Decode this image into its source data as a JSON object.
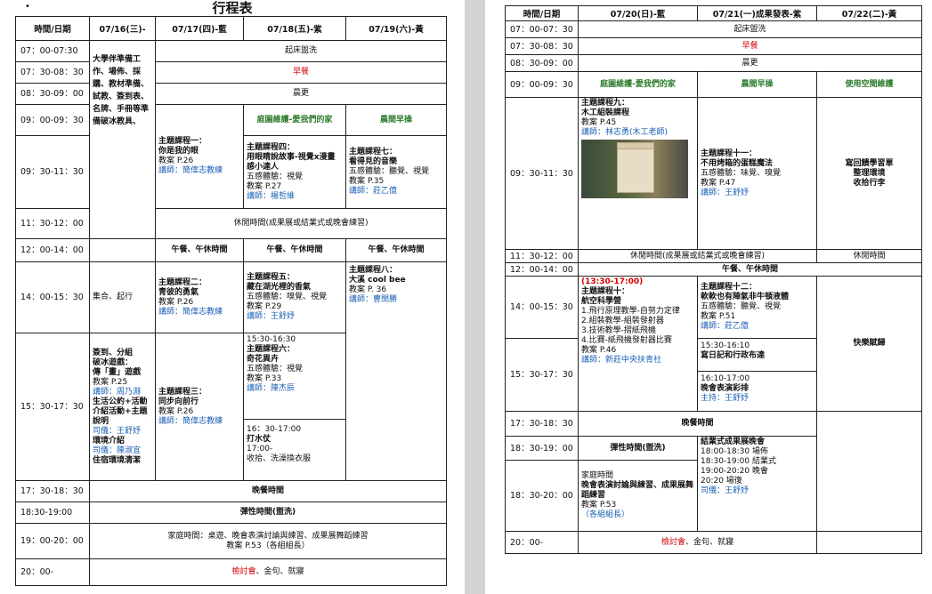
{
  "page1": {
    "title": "行程表",
    "headers": [
      "時間/日期",
      "07/16(三)-",
      "07/17(四)-藍",
      "07/18(五)-紫",
      "07/19(六)-黃"
    ],
    "times": [
      "07：00-07:30",
      "07：30-08：30",
      "08：30-09：00",
      "09：00-09：30",
      "09：30-11：30",
      "11：30-12：00",
      "12：00-14：00",
      "14：00-15：30",
      "15：30-17：30",
      "17：30-18：30",
      "18:30-19:00",
      "19：00-20：00",
      "20：00-"
    ],
    "wake": "起床盥洗",
    "breakfast": "早餐",
    "morning": "晨更",
    "d16_morning": "大學伴準備工作、場佈、採購、教材準備、試教、簽到表、名牌、手冊等準備破冰教具、",
    "d18_0900": "庭園維護-愛我們的家",
    "d19_0900": "晨間早操",
    "d17_am": {
      "l1": "主題課程一：",
      "l2": "你是我的眼",
      "l3": "教案 P.26",
      "l4": "講師：簡偉志教練"
    },
    "d18_am": {
      "l1": "主題課程四：",
      "l2": "用眼睛說故事-視覺x漫畫感小達人",
      "l3": "五感體驗：視覺",
      "l4": "教案 P.27",
      "l5": "講師：楊哲維"
    },
    "d19_am": {
      "l1": "主題課程七：",
      "l2": "看得見的音樂",
      "l3": "五感體驗：聽覺、視覺",
      "l4": "教案 P.35",
      "l5": "講師：莊乙億"
    },
    "rest": "休閒時間(成果展或結業式或晚會練習)",
    "lunch": "午餐、午休時間",
    "d16_gather": "集合、起行",
    "d17_pm1": {
      "l1": "主題課程二：",
      "l2": "青彼的勇氣",
      "l3": "教案 P.26",
      "l4": "講師：簡偉志教練"
    },
    "d18_pm1": {
      "l1": "主題課程五：",
      "l2": "藏在湖光裡的香氣",
      "l3": "五感體驗：嗅覺、視覺",
      "l4": "教案 P.29",
      "l5": "講師：王舒妤"
    },
    "d19_pm1": {
      "l1": "主題課程八：",
      "l2": "大溪 cool bee",
      "l3": "教案 P. 36",
      "l4": "講師：曹閔勝"
    },
    "d16_pm2": {
      "l1": "簽到、分組",
      "l2": "破冰遊戲：",
      "l3": "傳「畫」遊戲",
      "l4": "教案 P.25",
      "l5": "講師：周乃淵",
      "l6": "生活公約+活動介紹活動+主題說明",
      "l7": "司儀：王舒妤",
      "l8": "環境介紹",
      "l9": "司儀：陳淑宜",
      "l10": "住宿環境清潔"
    },
    "d17_pm2": {
      "l1": "主題課程三：",
      "l2": "同步向前行",
      "l3": "教案 P.26",
      "l4": "講師：簡偉志教練"
    },
    "d18_pm2a": {
      "l1": "15:30-16:30",
      "l2": "主題課程六：",
      "l3": "奇花異卉",
      "l4": "五感體驗：視覺",
      "l5": "教案 P.33",
      "l6": "講師：陳杰辰"
    },
    "d18_pm2b": {
      "l1": "16：30-17:00",
      "l2": "打水仗",
      "l3": "17:00-",
      "l4": "收拾、洗澡換衣服"
    },
    "dinner": "晚餐時間",
    "flex": "彈性時間(盥洗)",
    "evening_l1": "家庭時間：桌遊、晚會表演討論與練習、成果展舞蹈練習",
    "evening_l2": "教案 P.53（各組組長）",
    "night_red": "檢討會",
    "night_rest": "、金句、就寢"
  },
  "page2": {
    "headers": [
      "時間/日期",
      "07/20(日)-藍",
      "07/21(一)成果發表-紫",
      "07/22(二)-黃"
    ],
    "times": [
      "07：00-07：30",
      "07：30-08：30",
      "08：30-09：00",
      "09：00-09：30",
      "09：30-11：30",
      "11：30-12：00",
      "12：00-14：00",
      "14：00-15：30",
      "15：30-17：30",
      "17：30-18：30",
      "18：30-19：00",
      "18：30-20：00",
      "20：00-"
    ],
    "wake": "起床盥洗",
    "breakfast": "早餐",
    "morning": "晨更",
    "d20_0900": "庭園維護-愛我們的家",
    "d21_0900": "晨間早操",
    "d22_0900": "使用空間維護",
    "d20_am": {
      "l1": "主題課程九：",
      "l2": "木工組裝課程",
      "l3": "教案 P.45",
      "l4": "講師：林志勇(木工老師)"
    },
    "d21_am": {
      "l1": "主題課程十一：",
      "l2": "不用烤箱的蛋糕魔法",
      "l3": "五感體驗：味覺、嗅覺",
      "l4": "教案 P.47",
      "l5": "講師：王舒妤"
    },
    "d22_am": {
      "l1": "寫回饋學習單",
      "l2": "整理環境",
      "l3": "收拾行李"
    },
    "rest": "休閒時間(成果展或結業式或晚會練習)",
    "d22_rest": "休閒時間",
    "lunch": "午餐、午休時間",
    "d20_pm": {
      "l1": "(13:30-17:00)",
      "l2": "主題課程十：",
      "l3": "航空科學營",
      "l4": "1.飛行原理教學-自努力定律",
      "l5": "2.組裝教學-組裝發射器",
      "l6": "3.技術教學-摺紙飛機",
      "l7": "4.比賽-紙飛機發射器比賽",
      "l8": "教案 P.46",
      "l9": "講師：新莊中央扶青社"
    },
    "d21_pm1": {
      "l1": "主題課程十二：",
      "l2": "軟軟也有陣氣非牛頓液體",
      "l3": "五感體驗：聽覺、視覺",
      "l4": "教案 P.51",
      "l5": "講師：莊乙億"
    },
    "d21_pm2": {
      "l1": "15:30-16:10",
      "l2": "寫日記和行政布達"
    },
    "d21_pm3": {
      "l1": "16:10-17:00",
      "l2": "晚會表演彩排",
      "l3": "主持：王舒妤"
    },
    "d22_pm": "快樂賦歸",
    "dinner": "晚餐時間",
    "flex": "彈性時間(盥洗)",
    "d21_evening": {
      "l1": "結業式成果展晚會",
      "l2": "18:00-18:30 場佈",
      "l3": "18:30-19:00 結業式",
      "l4": "19:00-20:20 晚會",
      "l5": "20:20 場復",
      "l6": "司儀：王舒妤"
    },
    "d20_evening": {
      "l1": "家庭時間",
      "l2": "晚會表演討論與練習、成果展舞蹈練習",
      "l3": "教案 P.53",
      "l4": "（各組組長）"
    },
    "night_red": "檢討會",
    "night_rest": "、金句、就寢"
  },
  "colors": {
    "red": "#d40000",
    "blue": "#1a5fb4",
    "green": "#2a7a2a"
  },
  "icons": {
    "photo": "wooden-box-photo"
  }
}
